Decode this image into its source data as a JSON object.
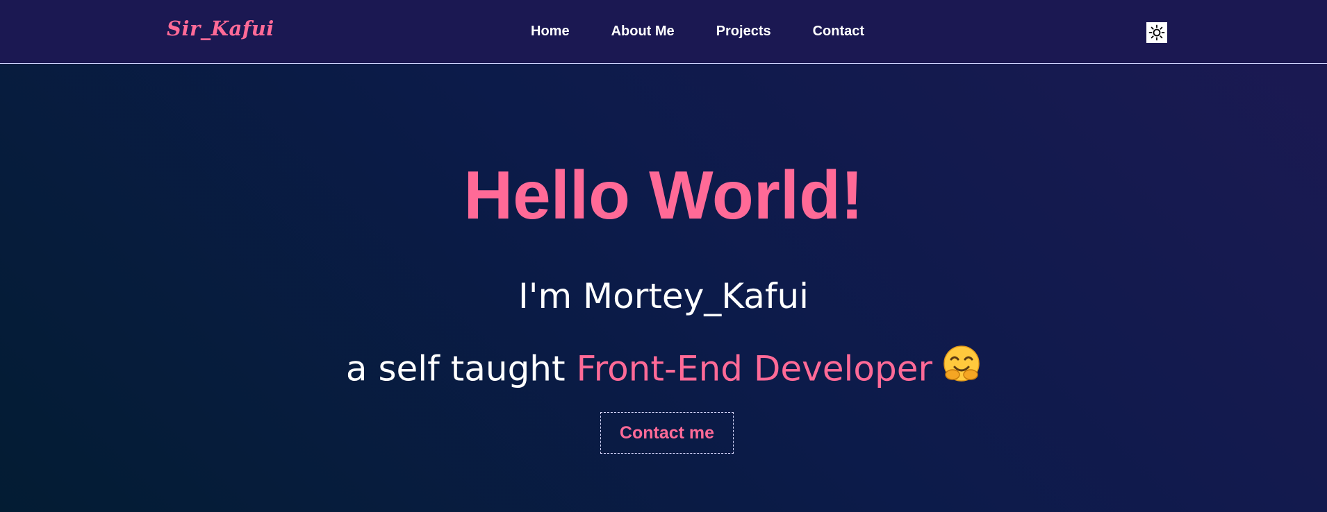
{
  "header": {
    "logo": "Sir_Kafui",
    "nav": [
      {
        "label": "Home"
      },
      {
        "label": "About Me"
      },
      {
        "label": "Projects"
      },
      {
        "label": "Contact"
      }
    ],
    "theme_toggle_icon": "sun-icon"
  },
  "hero": {
    "title": "Hello World!",
    "name_line": "I'm Mortey_Kafui",
    "tagline_prefix": "a self taught ",
    "tagline_highlight": "Front-End Developer",
    "emoji_icon": "hugging-face-emoji-icon",
    "cta_label": "Contact me"
  },
  "colors": {
    "accent": "#ff6a97",
    "nav_background": "#1b1852",
    "text": "#ffffff"
  }
}
